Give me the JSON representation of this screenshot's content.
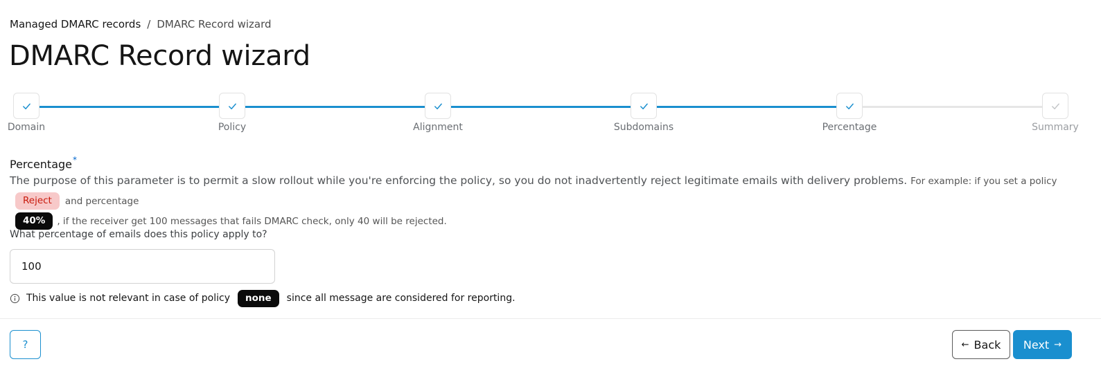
{
  "breadcrumb": {
    "parent": "Managed DMARC records",
    "separator": "/",
    "current": "DMARC Record wizard"
  },
  "page_title": "DMARC Record wizard",
  "stepper": {
    "steps": [
      {
        "label": "Domain",
        "status": "complete"
      },
      {
        "label": "Policy",
        "status": "complete"
      },
      {
        "label": "Alignment",
        "status": "complete"
      },
      {
        "label": "Subdomains",
        "status": "complete"
      },
      {
        "label": "Percentage",
        "status": "complete"
      },
      {
        "label": "Summary",
        "status": "pending"
      }
    ],
    "check_icon": "check-icon",
    "accent_color": "#1a8fcf"
  },
  "percentage_section": {
    "title": "Percentage",
    "required_marker": "*",
    "description": "The purpose of this parameter is to permit a slow rollout while you're enforcing the policy, so you do not inadvertently reject legitimate emails with delivery problems.",
    "example_prefix": "For example: if you set a policy",
    "example_policy_chip": "Reject",
    "example_middle": "and percentage",
    "example_percentage_chip": "40%",
    "example_suffix": ", if the receiver get 100 messages that fails DMARC check, only 40 will be rejected.",
    "field_label": "What percentage of emails does this policy apply to?",
    "field_value": "100",
    "helper_icon": "info-icon",
    "helper_prefix": "This value is not relevant in case of policy",
    "helper_chip": "none",
    "helper_suffix": "since all message are considered for reporting."
  },
  "footer": {
    "help_label": "?",
    "back_label": "Back",
    "back_icon": "arrow-left-icon",
    "next_label": "Next",
    "next_icon": "arrow-right-icon"
  }
}
